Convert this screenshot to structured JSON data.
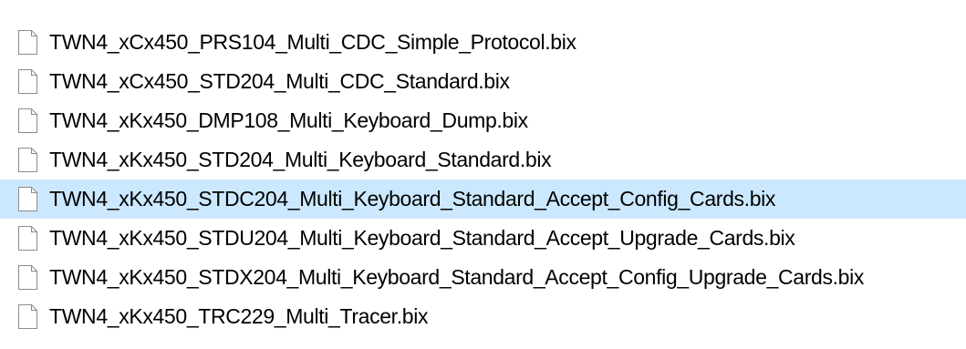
{
  "colors": {
    "selected_row_background": "#cce8ff",
    "text": "#000000"
  },
  "files": [
    {
      "name": "TWN4_xCx450_PRS104_Multi_CDC_Simple_Protocol.bix",
      "icon": "document-icon",
      "selected": false
    },
    {
      "name": "TWN4_xCx450_STD204_Multi_CDC_Standard.bix",
      "icon": "document-icon",
      "selected": false
    },
    {
      "name": "TWN4_xKx450_DMP108_Multi_Keyboard_Dump.bix",
      "icon": "document-icon",
      "selected": false
    },
    {
      "name": "TWN4_xKx450_STD204_Multi_Keyboard_Standard.bix",
      "icon": "document-icon",
      "selected": false
    },
    {
      "name": "TWN4_xKx450_STDC204_Multi_Keyboard_Standard_Accept_Config_Cards.bix",
      "icon": "document-icon",
      "selected": true
    },
    {
      "name": "TWN4_xKx450_STDU204_Multi_Keyboard_Standard_Accept_Upgrade_Cards.bix",
      "icon": "document-icon",
      "selected": false
    },
    {
      "name": "TWN4_xKx450_STDX204_Multi_Keyboard_Standard_Accept_Config_Upgrade_Cards.bix",
      "icon": "document-icon",
      "selected": false
    },
    {
      "name": "TWN4_xKx450_TRC229_Multi_Tracer.bix",
      "icon": "document-icon",
      "selected": false
    }
  ]
}
